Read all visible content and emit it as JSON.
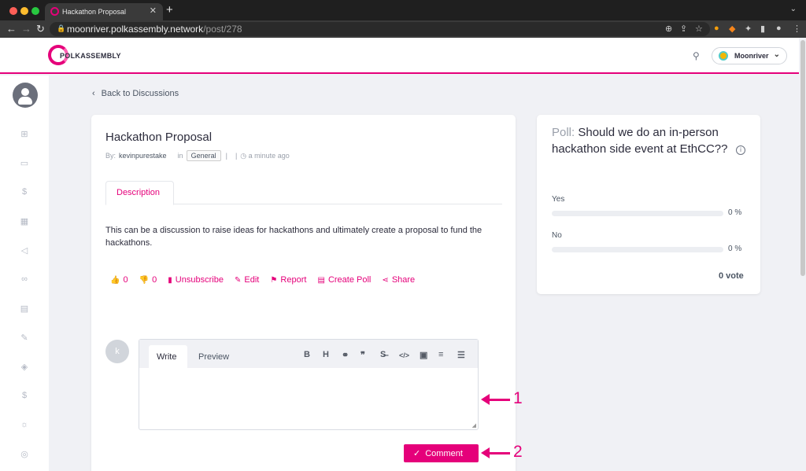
{
  "browser": {
    "tab_title": "Hackathon Proposal",
    "tab_close": "✕",
    "new_tab": "+",
    "tabs_menu": "⌄",
    "url_domain": "moonriver.polkassembly.network",
    "url_path": "/post/278",
    "nav": {
      "back": "←",
      "forward": "→",
      "reload": "↻",
      "lock": "🔒"
    },
    "toolbar_icons": [
      "zoom-icon",
      "share-icon",
      "star-icon",
      "extension-icon",
      "fox-icon",
      "puzzle-icon",
      "sidebar-icon",
      "profile-icon",
      "more-icon"
    ],
    "toolbar_glyphs": [
      "⊕",
      "⇪",
      "☆",
      "●",
      "◆",
      "✦",
      "▮",
      "●",
      "⋮"
    ]
  },
  "header": {
    "logo_text": "POLKASSEMBLY",
    "search_glyph": "⚲",
    "network": "Moonriver",
    "network_chevron": "⌄"
  },
  "sidebar": {
    "icons": [
      "overview-icon",
      "discussions-icon",
      "treasury-icon",
      "calendar-icon",
      "announcements-icon",
      "links-icon",
      "referenda-icon",
      "council-icon",
      "tech-committee-icon",
      "tips-icon",
      "motions-icon",
      "bounties-icon"
    ],
    "glyphs": [
      "⊞",
      "▭",
      "$",
      "▦",
      "◁",
      "∞",
      "▤",
      "✎",
      "◈",
      "$",
      "☼",
      "◎"
    ]
  },
  "back_link": {
    "chevron": "‹",
    "label": "Back to Discussions"
  },
  "post": {
    "title": "Hackathon Proposal",
    "by_label": "By:",
    "author": "kevinpurestake",
    "in_label": "in",
    "topic": "General",
    "separator": "|",
    "clock": "◷",
    "time": "a minute ago",
    "tab_description": "Description",
    "body": "This can be a discussion to raise ideas for hackathons and ultimately create a proposal to fund the hackathons."
  },
  "actions": {
    "like_icon": "👍",
    "like_count": "0",
    "dislike_icon": "👎",
    "dislike_count": "0",
    "unsubscribe_icon": "▮",
    "unsubscribe": "Unsubscribe",
    "edit_icon": "✎",
    "edit": "Edit",
    "report_icon": "⚑",
    "report": "Report",
    "poll_icon": "▤",
    "create_poll": "Create Poll",
    "share_icon": "⋖",
    "share": "Share"
  },
  "comment": {
    "avatar_letter": "k",
    "write_tab": "Write",
    "preview_tab": "Preview",
    "tools": [
      "B",
      "H",
      "⚭",
      "❞",
      "S̶",
      "</>",
      "▣",
      "≡",
      "☰"
    ],
    "tool_names": [
      "bold-icon",
      "heading-icon",
      "link-icon",
      "quote-icon",
      "strikethrough-icon",
      "code-icon",
      "image-icon",
      "ordered-list-icon",
      "unordered-list-icon"
    ],
    "grip": "◢",
    "button_check": "✓",
    "button_label": "Comment"
  },
  "annotations": {
    "one": "1",
    "two": "2"
  },
  "poll": {
    "label": "Poll:",
    "question": "Should we do an in-person hackathon side event at EthCC??",
    "info": "i",
    "options": [
      {
        "label": "Yes",
        "percent": "0 %",
        "fill": 0
      },
      {
        "label": "No",
        "percent": "0 %",
        "fill": 0
      }
    ],
    "votes": "0 vote"
  },
  "colors": {
    "accent": "#e5007a",
    "page_bg": "#f0f1f5"
  }
}
